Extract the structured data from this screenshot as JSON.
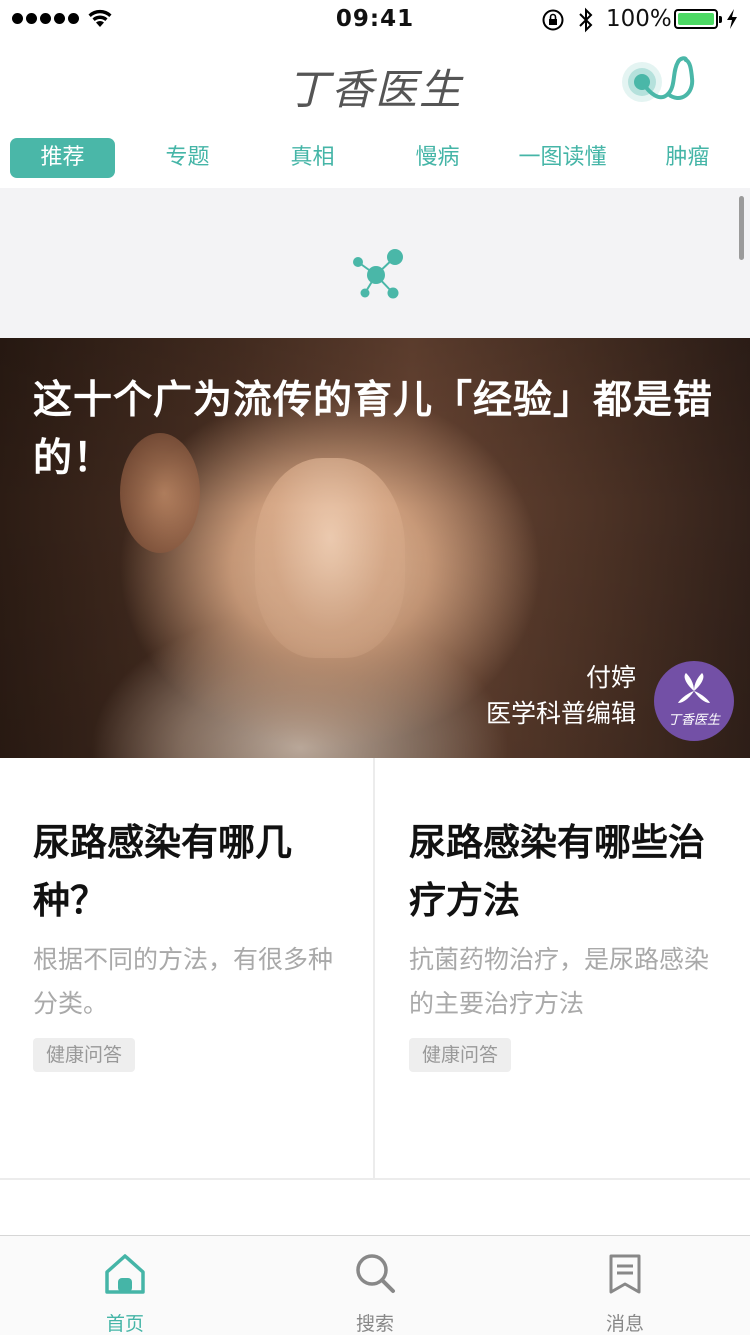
{
  "status_bar": {
    "time": "09:41",
    "battery_percent": "100%",
    "battery_level": 1.0
  },
  "nav": {
    "title": "丁香医生",
    "right_icon": "stethoscope-icon",
    "accent_color": "#4ab7a8"
  },
  "tabs": [
    {
      "label": "推荐",
      "active": true
    },
    {
      "label": "专题",
      "active": false
    },
    {
      "label": "真相",
      "active": false
    },
    {
      "label": "慢病",
      "active": false
    },
    {
      "label": "一图读懂",
      "active": false
    },
    {
      "label": "肿瘤",
      "active": false
    }
  ],
  "loading": {
    "icon": "molecule-loading-icon"
  },
  "hero": {
    "title": "这十个广为流传的育儿「经验」都是错的！",
    "author_name": "付婷",
    "author_role": "医学科普编辑",
    "badge_text": "丁香医生",
    "badge_color": "#7350a6"
  },
  "cards": [
    {
      "title": "尿路感染有哪几种？",
      "desc": "根据不同的方法，有很多种分类。",
      "tag": "健康问答"
    },
    {
      "title": "尿路感染有哪些治疗方法",
      "desc": "抗菌药物治疗，是尿路感染的主要治疗方法",
      "tag": "健康问答"
    }
  ],
  "tab_bar": [
    {
      "label": "首页",
      "icon": "home-icon",
      "active": true
    },
    {
      "label": "搜索",
      "icon": "search-icon",
      "active": false
    },
    {
      "label": "消息",
      "icon": "message-icon",
      "active": false
    }
  ]
}
